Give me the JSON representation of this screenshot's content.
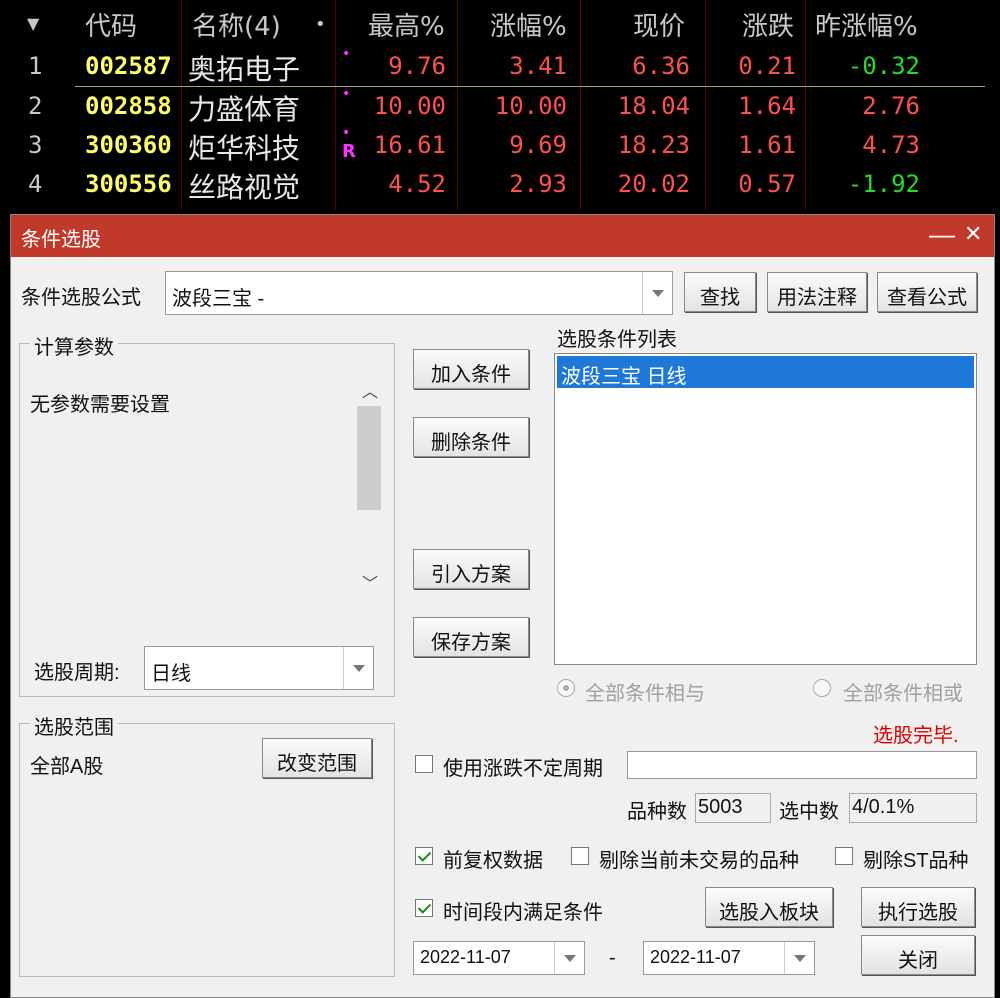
{
  "quote": {
    "headers": {
      "sort_icon": "triangle-down-icon",
      "code": "代码",
      "name": "名称(4)",
      "dot": "•",
      "high": "最高%",
      "change": "涨幅%",
      "price": "现价",
      "diff": "涨跌",
      "prev": "昨涨幅%"
    },
    "rows": [
      {
        "n": "1",
        "code": "002587",
        "name": "奥拓电子",
        "mark": "•",
        "high": "9.76",
        "change": "3.41",
        "price": "6.36",
        "diff": "0.21",
        "prev": "-0.32"
      },
      {
        "n": "2",
        "code": "002858",
        "name": "力盛体育",
        "mark": "•",
        "high": "10.00",
        "change": "10.00",
        "price": "18.04",
        "diff": "1.64",
        "prev": "2.76"
      },
      {
        "n": "3",
        "code": "300360",
        "name": "炬华科技",
        "mark": "•",
        "extra": "R",
        "high": "16.61",
        "change": "9.69",
        "price": "18.23",
        "diff": "1.61",
        "prev": "4.73"
      },
      {
        "n": "4",
        "code": "300556",
        "name": "丝路视觉",
        "mark": "",
        "high": "4.52",
        "change": "2.93",
        "price": "20.02",
        "diff": "0.57",
        "prev": "-1.92"
      }
    ]
  },
  "dialog": {
    "title": "条件选股",
    "minimize": "—",
    "close": "✕",
    "formula_label": "条件选股公式",
    "formula_value": "波段三宝      -",
    "btn_find": "查找",
    "btn_usage": "用法注释",
    "btn_view": "查看公式",
    "params_group": "计算参数",
    "params_text": "无参数需要设置",
    "period_label": "选股周期:",
    "period_value": "日线",
    "btn_add": "加入条件",
    "btn_delete": "删除条件",
    "btn_import": "引入方案",
    "btn_save": "保存方案",
    "cond_list_label": "选股条件列表",
    "cond_items": [
      "波段三宝  日线"
    ],
    "radio_and": "全部条件相与",
    "radio_or": "全部条件相或",
    "status": "选股完毕.",
    "range_group": "选股范围",
    "range_value": "全部A股",
    "btn_change_range": "改变范围",
    "use_period_label": "使用涨跌不定周期",
    "count_label": "品种数",
    "count_value": "5003",
    "selected_label": "选中数",
    "selected_value": "4/0.1%",
    "chk_forward": "前复权数据",
    "chk_exclude_untraded": "剔除当前未交易的品种",
    "chk_exclude_st": "剔除ST品种",
    "chk_time_range": "时间段内满足条件",
    "btn_to_block": "选股入板块",
    "btn_execute": "执行选股",
    "date_from": "2022-11-07",
    "date_sep": "-",
    "date_to": "2022-11-07",
    "btn_close": "关闭"
  },
  "colors": {
    "up": "#ff5050",
    "down": "#22dd22",
    "code": "#ffff66",
    "title_bar": "#c0392b",
    "selection": "#1e78d7",
    "status": "#e00000"
  }
}
